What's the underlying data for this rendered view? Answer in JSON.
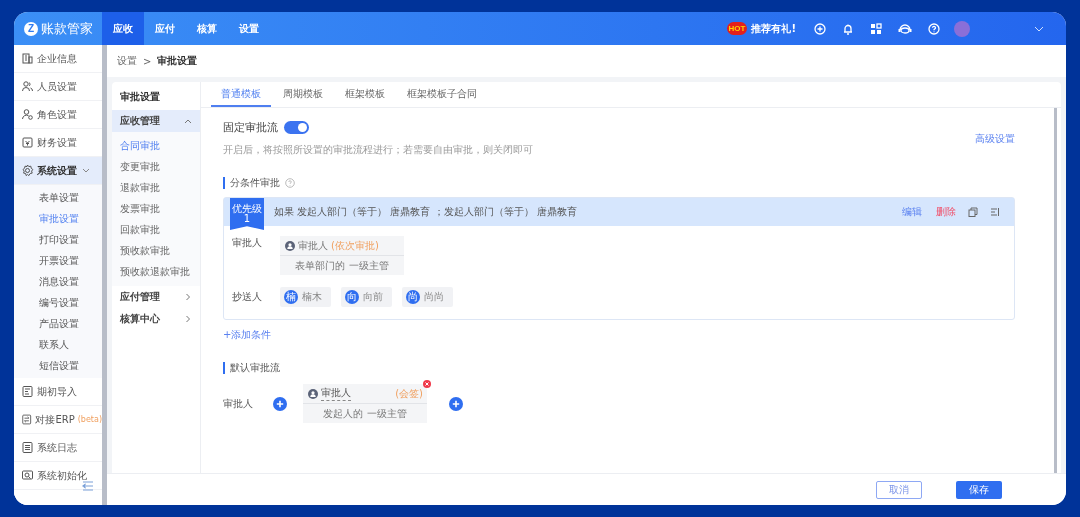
{
  "header": {
    "logo_mark": "Z",
    "logo_text": "账款管家",
    "nav": [
      {
        "label": "应收",
        "selected": true
      },
      {
        "label": "应付",
        "selected": false
      },
      {
        "label": "核算",
        "selected": false
      },
      {
        "label": "设置",
        "selected": false
      }
    ],
    "hot_badge": "HOT",
    "promo": "推荐有礼!"
  },
  "sidebar": {
    "items": [
      {
        "label": "企业信息",
        "selected": false
      },
      {
        "label": "人员设置",
        "selected": false
      },
      {
        "label": "角色设置",
        "selected": false
      },
      {
        "label": "财务设置",
        "selected": false
      },
      {
        "label": "系统设置",
        "selected": true,
        "expanded": true,
        "children": [
          {
            "label": "表单设置",
            "selected": false
          },
          {
            "label": "审批设置",
            "selected": true
          },
          {
            "label": "打印设置",
            "selected": false
          },
          {
            "label": "开票设置",
            "selected": false
          },
          {
            "label": "消息设置",
            "selected": false
          },
          {
            "label": "编号设置",
            "selected": false
          },
          {
            "label": "产品设置",
            "selected": false
          },
          {
            "label": "联系人",
            "selected": false
          },
          {
            "label": "短信设置",
            "selected": false
          }
        ]
      },
      {
        "label": "期初导入",
        "selected": false
      },
      {
        "label": "对接ERP",
        "selected": false,
        "badge": "(beta)"
      },
      {
        "label": "系统日志",
        "selected": false
      },
      {
        "label": "系统初始化",
        "selected": false
      }
    ]
  },
  "breadcrumb": {
    "items": [
      "设置",
      "审批设置"
    ],
    "separator": ">"
  },
  "subnav": {
    "title": "审批设置",
    "groups": [
      {
        "label": "应收管理",
        "expanded": true,
        "children": [
          {
            "label": "合同审批",
            "selected": true
          },
          {
            "label": "变更审批",
            "selected": false
          },
          {
            "label": "退款审批",
            "selected": false
          },
          {
            "label": "发票审批",
            "selected": false
          },
          {
            "label": "回款审批",
            "selected": false
          },
          {
            "label": "预收款审批",
            "selected": false
          },
          {
            "label": "预收款退款审批",
            "selected": false
          }
        ]
      },
      {
        "label": "应付管理",
        "expanded": false
      },
      {
        "label": "核算中心",
        "expanded": false
      }
    ]
  },
  "tabs": [
    {
      "label": "普通模板",
      "selected": true
    },
    {
      "label": "周期模板",
      "selected": false
    },
    {
      "label": "框架模板",
      "selected": false
    },
    {
      "label": "框架模板子合同",
      "selected": false
    }
  ],
  "fixed_flow": {
    "label": "固定审批流",
    "on": true,
    "hint": "开启后，将按照所设置的审批流程进行；若需要自由审批，则关闭即可",
    "advanced_link": "高级设置"
  },
  "conditional": {
    "title": "分条件审批",
    "rule": {
      "priority_label": "优先级",
      "priority": "1",
      "condition": "如果 发起人部门（等于） 唐鼎教育 ；发起人部门（等于） 唐鼎教育",
      "actions": [
        {
          "label": "编辑",
          "kind": "edit"
        },
        {
          "label": "删除",
          "kind": "delete"
        }
      ],
      "approver_label": "审批人",
      "approver": {
        "title": "审批人",
        "mode": "(依次审批)",
        "desc": "表单部门的 一级主管"
      },
      "cc_label": "抄送人",
      "cc": [
        {
          "initial": "楠",
          "name": "楠木"
        },
        {
          "initial": "向",
          "name": "向前"
        },
        {
          "initial": "尚",
          "name": "尚尚"
        }
      ]
    },
    "add_link": "+添加条件"
  },
  "default_flow": {
    "title": "默认审批流",
    "approver_label": "审批人",
    "approver": {
      "title": "审批人",
      "mode": "(会签)",
      "desc": "发起人的 一级主管"
    }
  },
  "footer": {
    "buttons": [
      {
        "label": "取消",
        "kind": "secondary"
      },
      {
        "label": "保存",
        "kind": "primary"
      }
    ]
  }
}
